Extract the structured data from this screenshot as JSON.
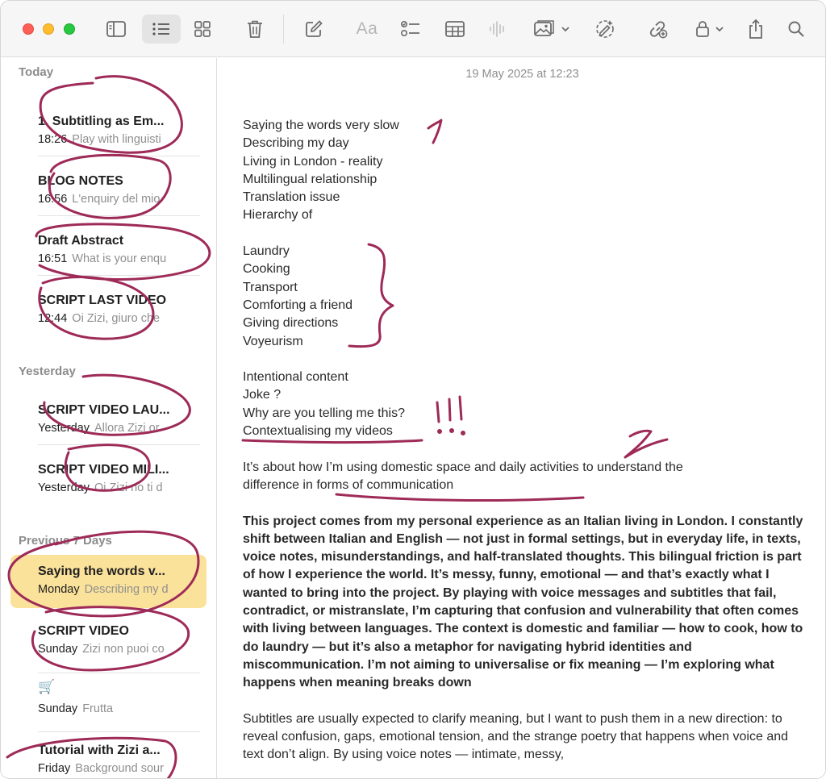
{
  "toolbar": {
    "icons": [
      "sidebar-toggle-icon",
      "list-view-icon",
      "gallery-view-icon",
      "trash-icon",
      "compose-icon",
      "format-icon",
      "checklist-icon",
      "table-icon",
      "audio-icon",
      "media-icon",
      "collaborate-icon",
      "link-icon",
      "lock-icon",
      "share-icon",
      "search-icon"
    ],
    "format_label": "Aa"
  },
  "sidebar": {
    "sections": [
      {
        "heading": "Today"
      },
      {
        "heading": "Yesterday"
      },
      {
        "heading": "Previous 7 Days"
      }
    ],
    "notes": [
      {
        "title": "1. Subtitling as Em...",
        "time": "18:26",
        "preview": "Play with linguisti"
      },
      {
        "title": "BLOG NOTES",
        "time": "16:56",
        "preview": "L'enquiry del mio"
      },
      {
        "title": "Draft Abstract",
        "time": "16:51",
        "preview": "What is your enqu"
      },
      {
        "title": "SCRIPT LAST VIDEO",
        "time": "12:44",
        "preview": "Oi Zizi, giuro che"
      },
      {
        "title": "SCRIPT VIDEO LAU...",
        "time": "Yesterday",
        "preview": "Allora Zizi or"
      },
      {
        "title": "SCRIPT VIDEO MILI...",
        "time": "Yesterday",
        "preview": "Oi Zizi no ti d"
      },
      {
        "title": "Saying the words v...",
        "time": "Monday",
        "preview": "Describing my d"
      },
      {
        "title": "SCRIPT VIDEO",
        "time": "Sunday",
        "preview": "Zizi non puoi co"
      },
      {
        "title": "🛒",
        "time": "Sunday",
        "preview": "Frutta"
      },
      {
        "title": "Tutorial with Zizi a...",
        "time": "Friday",
        "preview": "Background sour"
      }
    ]
  },
  "editor": {
    "date": "19 May 2025 at 12:23",
    "lines1": [
      "Saying the words very slow",
      "Describing my day",
      "Living in London - reality",
      "Multilingual relationship",
      "Translation issue",
      "Hierarchy of"
    ],
    "lines2": [
      "Laundry",
      "Cooking",
      "Transport",
      "Comforting a friend",
      "Giving directions",
      "Voyeurism"
    ],
    "lines3": [
      "Intentional content",
      "Joke ?",
      "Why are you telling me this?",
      "Contextualising my videos"
    ],
    "para1_line1": "It’s about how I’m using domestic space and daily activities to understand the",
    "para1_line2": "difference in forms of communication",
    "para2": "This project comes from my personal experience as an Italian living in London. I constantly shift between Italian and English — not just in formal settings, but in everyday life, in texts, voice notes, misunderstandings, and half-translated thoughts. This bilingual friction is part of how I experience the world. It’s messy, funny, emotional — and that’s exactly what I wanted to bring into the project. By playing with voice messages and subtitles that fail, contradict, or mistranslate, I’m capturing that confusion and vulnerability that often comes with living between languages. The context is domestic and familiar — how to cook, how to do laundry — but it’s also a metaphor for navigating hybrid identities and miscommunication. I’m not aiming to universalise or fix meaning — I’m exploring what happens when meaning breaks down",
    "para3": "Subtitles are usually expected to clarify meaning, but I want to push them in a new direction: to reveal confusion, gaps, emotional tension, and the strange poetry that happens when voice and text don’t align. By using voice notes — intimate, messy,"
  },
  "colors": {
    "ink": "#9e2a58",
    "selected_note": "#fbe29b",
    "accent": "#febc2e"
  }
}
